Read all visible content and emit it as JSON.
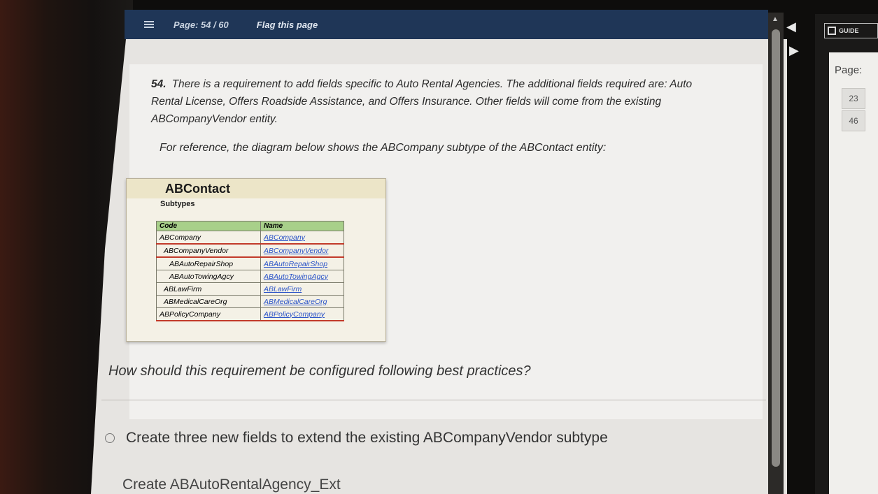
{
  "header": {
    "page_indicator": "Page: 54 / 60",
    "flag_label": "Flag this page"
  },
  "question": {
    "number": "54.",
    "text": "There is a requirement to add fields specific to Auto Rental Agencies. The additional fields required are: Auto Rental License, Offers Roadside Assistance, and Offers Insurance. Other fields will come from the existing ABCompanyVendor entity.",
    "reference": "For reference, the diagram below shows the ABCompany subtype of the ABContact entity:",
    "prompt": "How should this requirement be configured following best practices?"
  },
  "diagram": {
    "title": "ABContact",
    "subtitle": "Subtypes",
    "columns": [
      "Code",
      "Name"
    ],
    "rows": [
      {
        "code": "ABCompany",
        "name": "ABCompany"
      },
      {
        "code": "ABCompanyVendor",
        "name": "ABCompanyVendor"
      },
      {
        "code": "ABAutoRepairShop",
        "name": "ABAutoRepairShop"
      },
      {
        "code": "ABAutoTowingAgcy",
        "name": "ABAutoTowingAgcy"
      },
      {
        "code": "ABLawFirm",
        "name": "ABLawFirm"
      },
      {
        "code": "ABMedicalCareOrg",
        "name": "ABMedicalCareOrg"
      },
      {
        "code": "ABPolicyCompany",
        "name": "ABPolicyCompany"
      }
    ]
  },
  "options": [
    {
      "label": "Create three new fields to extend the existing ABCompanyVendor subtype"
    },
    {
      "label": "Create ABAutoRentalAgency_Ext"
    }
  ],
  "side_panel": {
    "logo_text": "GUIDE",
    "page_label": "Page:",
    "page_buttons": [
      "23",
      "46"
    ]
  },
  "icons": {
    "menu": "menu-icon",
    "prev": "triangle-left-icon",
    "next": "triangle-right-icon",
    "scroll_up": "triangle-up-icon"
  },
  "colors": {
    "header_bg": "#1f3657",
    "diagram_header": "#a8d08a",
    "link": "#2a53c8",
    "highlight": "#c23a2a"
  }
}
